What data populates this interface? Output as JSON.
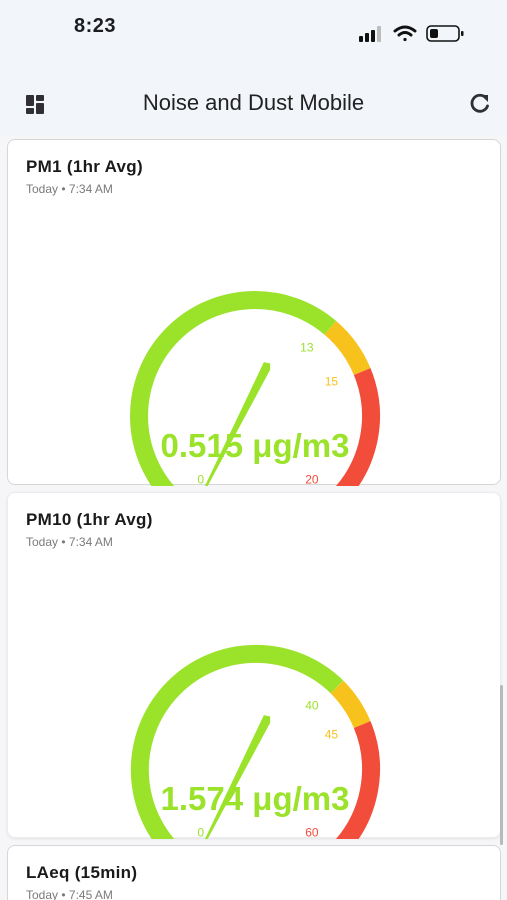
{
  "status_bar": {
    "time": "8:23",
    "signal_icon": "cellular-signal-icon",
    "wifi_icon": "wifi-icon",
    "battery_icon": "battery-low-icon"
  },
  "header": {
    "title": "Noise and Dust Mobile",
    "menu_icon": "dashboard-grid-icon",
    "refresh_icon": "refresh-icon"
  },
  "colors": {
    "green": "#9be22a",
    "amber": "#f8c21c",
    "red": "#f24c3a"
  },
  "cards": [
    {
      "title": "PM1 (1hr Avg)",
      "timestamp": "Today • 7:34 AM",
      "reading": "0.515 μg/m3",
      "gauge": {
        "min": 0,
        "max": 20,
        "value": 0.515,
        "warn": 13,
        "alert": 15,
        "labels": {
          "min": "0",
          "warn": "13",
          "alert": "15",
          "max": "20"
        }
      }
    },
    {
      "title": "PM10 (1hr Avg)",
      "timestamp": "Today • 7:34 AM",
      "reading": "1.574 μg/m3",
      "gauge": {
        "min": 0,
        "max": 60,
        "value": 1.574,
        "warn": 40,
        "alert": 45,
        "labels": {
          "min": "0",
          "warn": "40",
          "alert": "45",
          "max": "60"
        }
      }
    },
    {
      "title": "LAeq (15min)",
      "timestamp": "Today • 7:45 AM"
    }
  ]
}
